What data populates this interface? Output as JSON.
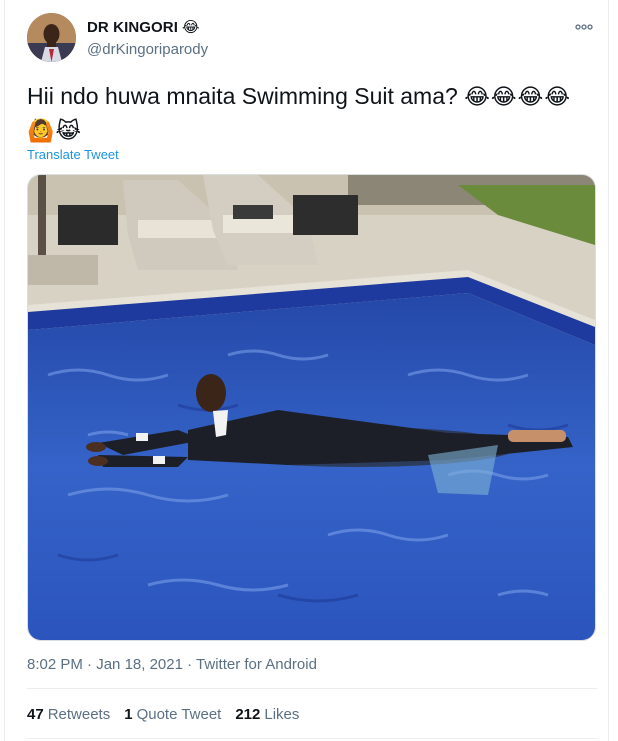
{
  "author": {
    "name": "DR KINGORI",
    "name_emoji": "😂",
    "handle": "@drKingoriparody"
  },
  "tweet": {
    "text": "Hii ndo huwa mnaita Swimming Suit ama?",
    "emojis_line1": "😂😂😂😂",
    "emojis_line2": "🙆😹",
    "translate_label": "Translate Tweet"
  },
  "meta": {
    "time": "8:02 PM",
    "date": "Jan 18, 2021",
    "client": "Twitter for Android",
    "separator": "·"
  },
  "stats": {
    "retweets_count": "47",
    "retweets_label": "Retweets",
    "quotes_count": "1",
    "quotes_label": "Quote Tweet",
    "likes_count": "212",
    "likes_label": "Likes"
  },
  "colors": {
    "link": "#1b95e0",
    "secondary_text": "#5b7083",
    "pool_water": "#2e56c0",
    "pool_tile": "#1f3a9e"
  }
}
